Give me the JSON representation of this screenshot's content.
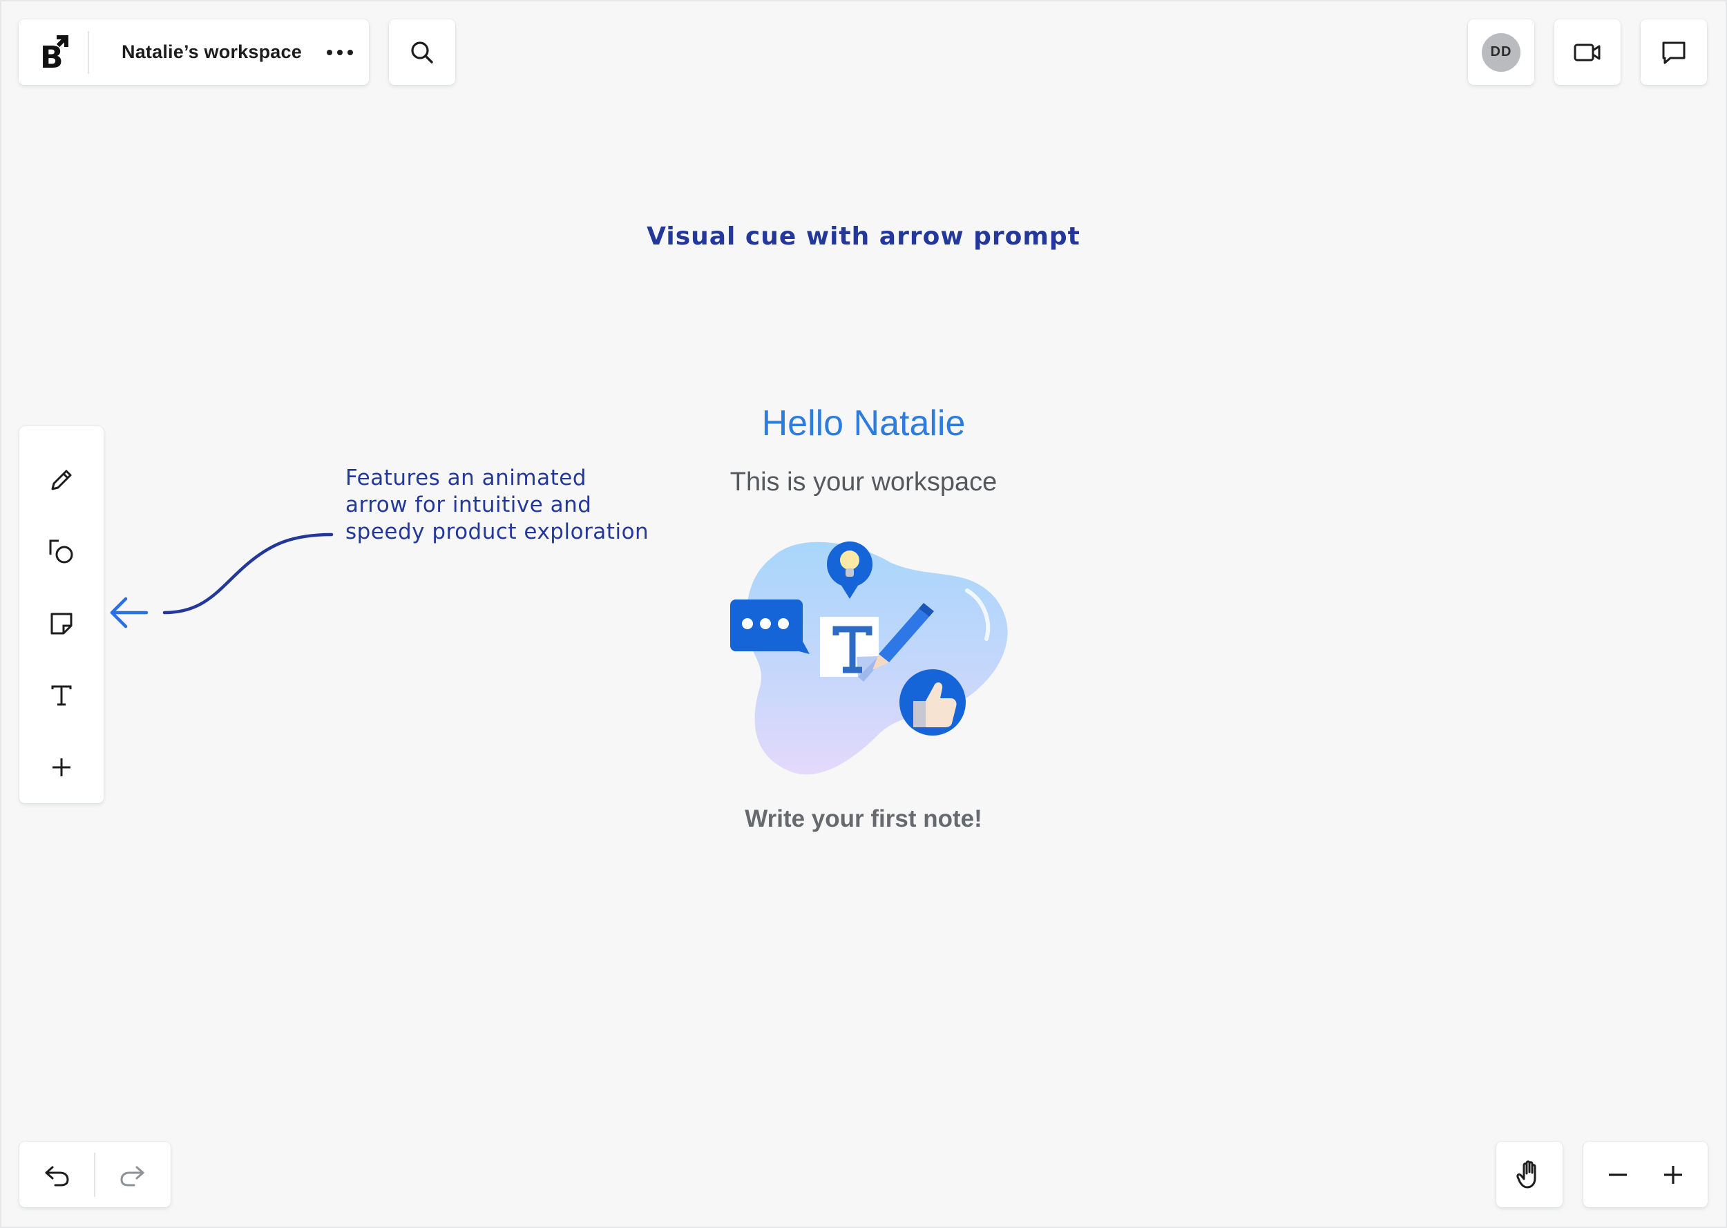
{
  "header": {
    "logo_icon": "brand-logo-icon",
    "workspace_name": "Natalie’s workspace",
    "more_icon": "more-horizontal-icon",
    "search_icon": "search-icon",
    "avatar_initials": "DD",
    "video_icon": "video-camera-icon",
    "chat_icon": "chat-bubble-icon"
  },
  "toolbar": {
    "items": [
      {
        "name": "pencil-icon",
        "label": "Pen"
      },
      {
        "name": "shapes-icon",
        "label": "Shapes"
      },
      {
        "name": "sticky-note-icon",
        "label": "Sticky note"
      },
      {
        "name": "text-icon",
        "label": "Text"
      },
      {
        "name": "plus-icon",
        "label": "More"
      }
    ]
  },
  "canvas": {
    "prompt_title": "Visual cue with arrow prompt",
    "annotation_lines": [
      "Features an animated",
      "arrow for intuitive and",
      "speedy product exploration"
    ],
    "hello": "Hello Natalie",
    "subtitle": "This is your workspace",
    "cta": "Write your first note!"
  },
  "footer": {
    "undo_icon": "undo-icon",
    "redo_icon": "redo-icon",
    "hand_icon": "hand-pan-icon",
    "zoom_out_icon": "minus-icon",
    "zoom_in_icon": "plus-icon"
  },
  "colors": {
    "background": "#f6f7f6",
    "annotation": "#23389a",
    "accent_blue": "#2d7ce0",
    "arrow_blue": "#2a6fe6"
  }
}
